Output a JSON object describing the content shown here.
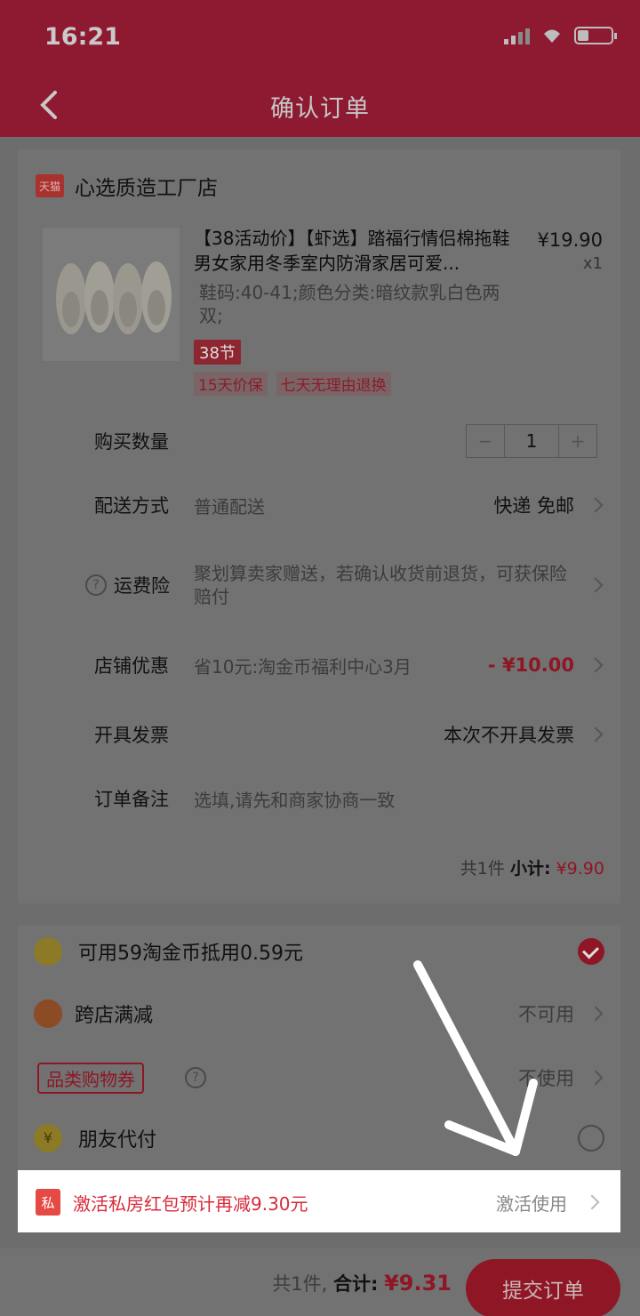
{
  "status_bar": {
    "time": "16:21"
  },
  "header": {
    "title": "确认订单"
  },
  "shop": {
    "badge": "天猫",
    "name": "心选质造工厂店"
  },
  "product": {
    "title": "【38活动价】【虾选】踏福行情侣棉拖鞋男女家用冬季室内防滑家居可爱...",
    "price": "¥19.90",
    "quantity_label": "x1",
    "sku": "鞋码:40-41;颜色分类:暗纹款乳白色两双;",
    "promo_tag": "38节",
    "services": [
      "15天价保",
      "七天无理由退换"
    ]
  },
  "rows": {
    "quantity": {
      "label": "购买数量",
      "minus": "−",
      "value": "1",
      "plus": "+"
    },
    "delivery": {
      "label": "配送方式",
      "value": "普通配送",
      "right": "快递 免邮"
    },
    "insurance": {
      "label": "运费险",
      "value": "聚划算卖家赠送，若确认收货前退货，可获保险赔付"
    },
    "shop_discount": {
      "label": "店铺优惠",
      "value": "省10元:淘金币福利中心3月",
      "right": "- ¥10.00"
    },
    "invoice": {
      "label": "开具发票",
      "right": "本次不开具发票"
    },
    "note": {
      "label": "订单备注",
      "placeholder": "选填,请先和商家协商一致"
    }
  },
  "subtotal": {
    "count": "共1件",
    "label": "小计:",
    "amount": "¥9.90"
  },
  "discounts": {
    "coins": {
      "label": "可用59淘金币抵用0.59元",
      "checked": true
    },
    "cross_store": {
      "label": "跨店满减",
      "value": "不可用"
    },
    "category_coupon": {
      "label": "品类购物券",
      "value": "不使用"
    },
    "friend_pay": {
      "label": "朋友代付",
      "checked": false
    }
  },
  "banner": {
    "icon_text": "私",
    "text": "激活私房红包预计再减9.30元",
    "action": "激活使用"
  },
  "footer": {
    "count": "共1件,",
    "total_label": "合计:",
    "total": "¥9.31",
    "submit": "提交订单"
  },
  "colors": {
    "theme_red": "#8e1625",
    "highlight_red": "#d82a3a"
  },
  "icons": [
    "back-arrow-icon",
    "signal-icon",
    "wifi-icon",
    "battery-icon",
    "chevron-right-icon",
    "question-icon",
    "coin-icon",
    "cross-store-icon",
    "yuan-icon",
    "check-icon",
    "annotation-arrow"
  ]
}
